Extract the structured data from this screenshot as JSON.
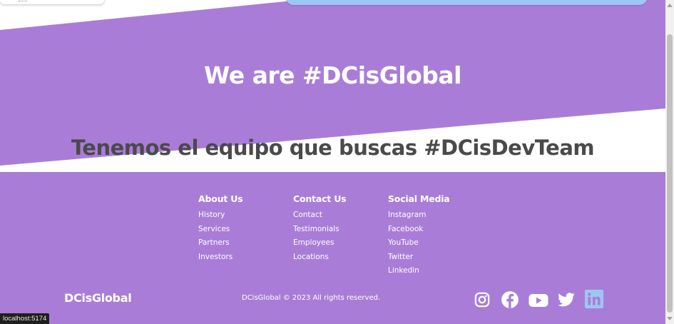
{
  "hero": {
    "title": "We are #DCisGlobal",
    "subtitle": "Tenemos el equipo que buscas #DCisDevTeam"
  },
  "footer": {
    "columns": [
      {
        "heading": "About Us",
        "links": [
          "History",
          "Services",
          "Partners",
          "Investors"
        ]
      },
      {
        "heading": "Contact Us",
        "links": [
          "Contact",
          "Testimonials",
          "Employees",
          "Locations"
        ]
      },
      {
        "heading": "Social Media",
        "links": [
          "Instagram",
          "Facebook",
          "YouTube",
          "Twitter",
          "Linkedin"
        ]
      }
    ],
    "brand": "DCisGlobal",
    "copyright": "DCisGlobal © 2023 All rights reserved.",
    "social_icons": [
      "instagram-icon",
      "facebook-icon",
      "youtube-icon",
      "twitter-icon",
      "linkedin-icon"
    ]
  },
  "status_bar": {
    "url": "localhost:5174"
  },
  "colors": {
    "background": "#a97dd7",
    "white": "#ffffff",
    "subtitle_text": "#4a4a4a",
    "linkedin_accent": "#9ec6f2"
  }
}
